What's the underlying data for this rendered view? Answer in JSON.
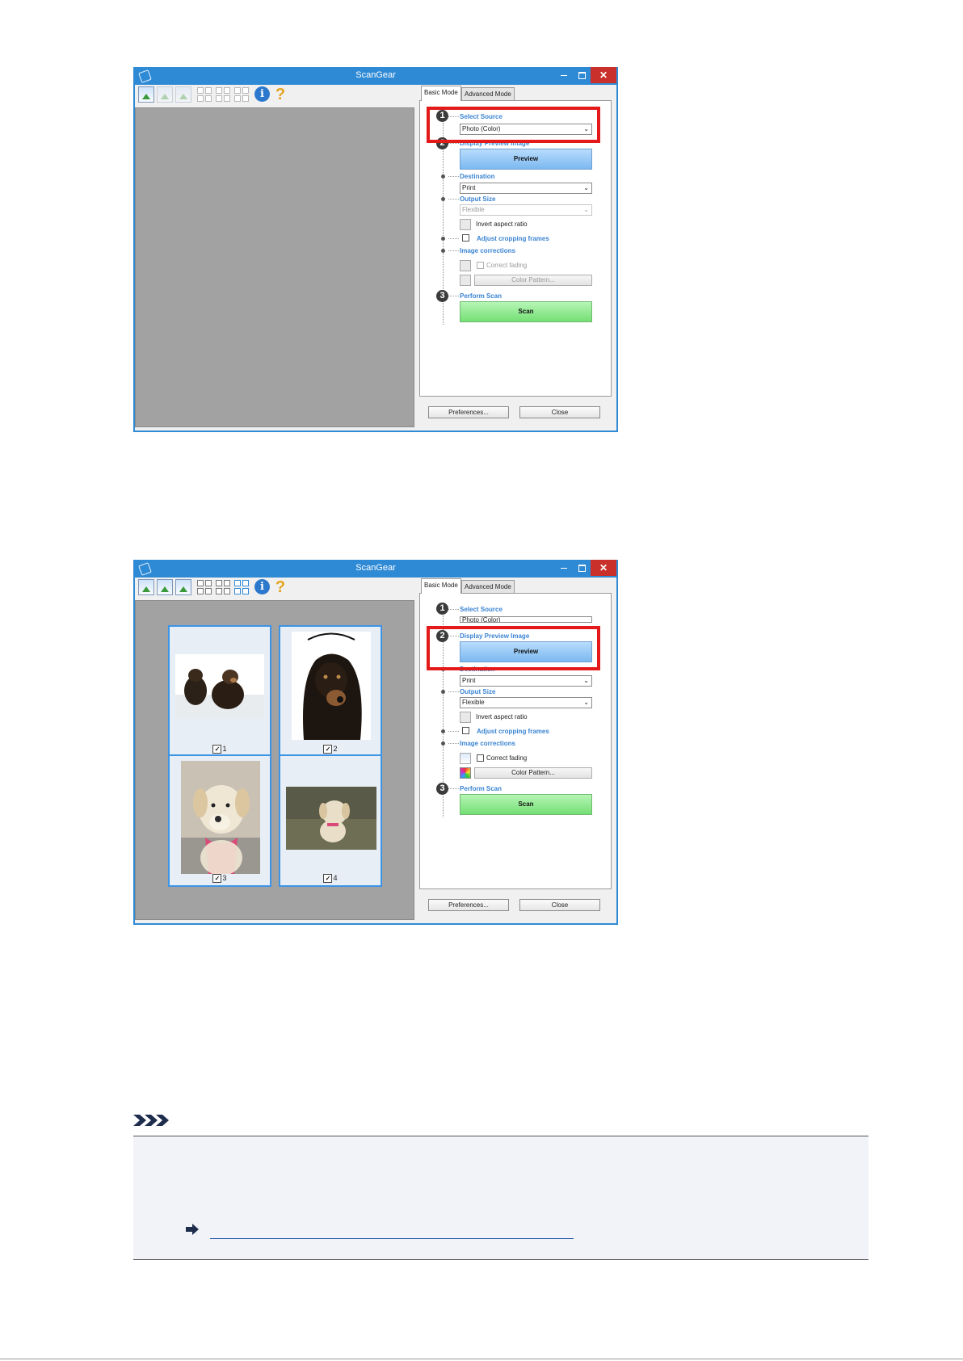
{
  "window1": {
    "title": "ScanGear",
    "tabs": [
      "Basic Mode",
      "Advanced Mode"
    ],
    "steps": [
      "1",
      "2",
      "3"
    ],
    "select_source": {
      "label": "Select Source",
      "value": "Photo (Color)"
    },
    "display_preview": {
      "label": "Display Preview Image",
      "button": "Preview"
    },
    "destination": {
      "label": "Destination",
      "value": "Print"
    },
    "output_size": {
      "label": "Output Size",
      "value": "Flexible"
    },
    "invert_aspect": "Invert aspect ratio",
    "adjust_cropping": "Adjust cropping frames",
    "image_corrections": {
      "label": "Image corrections",
      "correct_fading": "Correct fading",
      "color_pattern": "Color Pattern..."
    },
    "perform_scan": {
      "label": "Perform Scan",
      "button": "Scan"
    },
    "preferences": "Preferences...",
    "close": "Close"
  },
  "window2": {
    "title": "ScanGear",
    "tabs": [
      "Basic Mode",
      "Advanced Mode"
    ],
    "steps": [
      "1",
      "2",
      "3"
    ],
    "select_source": {
      "label": "Select Source",
      "value": "Photo (Color)"
    },
    "display_preview": {
      "label": "Display Preview Image",
      "button": "Preview"
    },
    "destination": {
      "label": "Destination",
      "value": "Print"
    },
    "output_size": {
      "label": "Output Size",
      "value": "Flexible"
    },
    "invert_aspect": "Invert aspect ratio",
    "adjust_cropping": "Adjust cropping frames",
    "image_corrections": {
      "label": "Image corrections",
      "correct_fading": "Correct fading",
      "color_pattern": "Color Pattern..."
    },
    "perform_scan": {
      "label": "Perform Scan",
      "button": "Scan"
    },
    "preferences": "Preferences...",
    "close": "Close",
    "thumbnails": [
      {
        "number": "1",
        "checked": true
      },
      {
        "number": "2",
        "checked": true
      },
      {
        "number": "3",
        "checked": true
      },
      {
        "number": "4",
        "checked": true
      }
    ]
  },
  "colors": {
    "titlebar": "#2f8ad6",
    "highlight": "#e41a1a",
    "section_label": "#3a84d2",
    "preview_button": "#7cb9f0",
    "scan_button": "#74df74"
  },
  "icons": [
    "app-icon",
    "minimize-icon",
    "maximize-icon",
    "close-icon",
    "photo-tool-icon",
    "grid-tool-icon",
    "info-icon",
    "help-icon",
    "note-icon",
    "arrow-right-icon"
  ]
}
